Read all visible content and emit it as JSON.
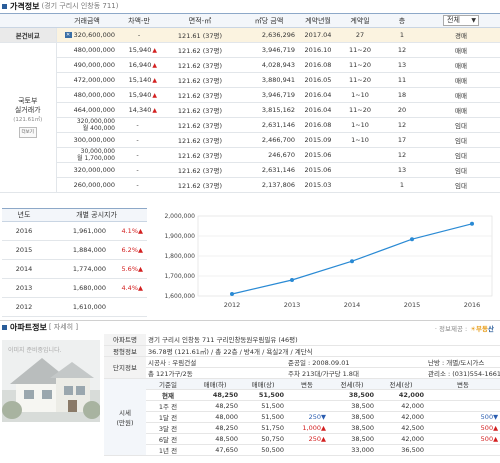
{
  "price_section": {
    "title": "가격정보",
    "subtitle": "(경기 구리시 인창동 711)",
    "headers": {
      "amount": "거래금액",
      "diff": "차액-만",
      "area": "면적-㎡",
      "per_m2": "㎡당 금액",
      "contract_date": "계약년월",
      "contract_day": "계약일",
      "floor": "층"
    },
    "filter": {
      "value": "전체",
      "arrow": "▼"
    },
    "base": {
      "label": "본건비교",
      "badge": "✕",
      "amount": "320,600,000",
      "diff": "-",
      "area": "121.61 (37평)",
      "per_m2": "2,636,296",
      "contract_date": "2017.04",
      "day": "27",
      "floor": "1",
      "type": "경매"
    },
    "group_label_1": "국토부",
    "group_label_2": "실거래가",
    "group_label_3": "(121.61㎡)",
    "group_button": "더보기",
    "rows": [
      {
        "amount": "480,000,000",
        "diff": "15,940",
        "diff_arrow": "▲",
        "area": "121.62 (37평)",
        "per_m2": "3,946,719",
        "date": "2016.10",
        "day": "11~20",
        "floor": "12",
        "type": "매매"
      },
      {
        "amount": "490,000,000",
        "diff": "16,940",
        "diff_arrow": "▲",
        "area": "121.62 (37평)",
        "per_m2": "4,028,943",
        "date": "2016.08",
        "day": "11~20",
        "floor": "13",
        "type": "매매"
      },
      {
        "amount": "472,000,000",
        "diff": "15,140",
        "diff_arrow": "▲",
        "area": "121.62 (37평)",
        "per_m2": "3,880,941",
        "date": "2016.05",
        "day": "11~20",
        "floor": "11",
        "type": "매매"
      },
      {
        "amount": "480,000,000",
        "diff": "15,940",
        "diff_arrow": "▲",
        "area": "121.62 (37평)",
        "per_m2": "3,946,719",
        "date": "2016.04",
        "day": "1~10",
        "floor": "18",
        "type": "매매"
      },
      {
        "amount": "464,000,000",
        "diff": "14,340",
        "diff_arrow": "▲",
        "area": "121.62 (37평)",
        "per_m2": "3,815,162",
        "date": "2016.04",
        "day": "11~20",
        "floor": "20",
        "type": "매매"
      },
      {
        "amount": "320,000,000",
        "amount2": "월 400,000",
        "diff": "-",
        "diff_arrow": "",
        "area": "121.62 (37평)",
        "per_m2": "2,631,146",
        "date": "2016.08",
        "day": "1~10",
        "floor": "12",
        "type": "임대"
      },
      {
        "amount": "300,000,000",
        "diff": "-",
        "diff_arrow": "",
        "area": "121.62 (37평)",
        "per_m2": "2,466,700",
        "date": "2015.09",
        "day": "1~10",
        "floor": "17",
        "type": "임대"
      },
      {
        "amount": "30,000,000",
        "amount2": "월 1,700,000",
        "diff": "-",
        "diff_arrow": "",
        "area": "121.62 (37평)",
        "per_m2": "246,670",
        "date": "2015.06",
        "day": "",
        "floor": "12",
        "type": "임대"
      },
      {
        "amount": "320,000,000",
        "diff": "-",
        "diff_arrow": "",
        "area": "121.62 (37평)",
        "per_m2": "2,631,146",
        "date": "2015.06",
        "day": "",
        "floor": "13",
        "type": "임대"
      },
      {
        "amount": "260,000,000",
        "diff": "-",
        "diff_arrow": "",
        "area": "121.62 (37평)",
        "per_m2": "2,137,806",
        "date": "2015.03",
        "day": "",
        "floor": "1",
        "type": "임대"
      }
    ]
  },
  "official_price": {
    "headers": {
      "year": "년도",
      "price": "개별 공시지가"
    },
    "rows": [
      {
        "year": "2016",
        "price": "1,961,000",
        "pct": "4.1%",
        "arrow": "▲"
      },
      {
        "year": "2015",
        "price": "1,884,000",
        "pct": "6.2%",
        "arrow": "▲"
      },
      {
        "year": "2014",
        "price": "1,774,000",
        "pct": "5.6%",
        "arrow": "▲"
      },
      {
        "year": "2013",
        "price": "1,680,000",
        "pct": "4.4%",
        "arrow": "▲"
      },
      {
        "year": "2012",
        "price": "1,610,000",
        "pct": "",
        "arrow": ""
      }
    ]
  },
  "chart_data": {
    "type": "line",
    "title": "",
    "xlabel": "",
    "ylabel": "",
    "x": [
      "2012",
      "2013",
      "2014",
      "2015",
      "2016"
    ],
    "series": [
      {
        "values": [
          1610000,
          1680000,
          1774000,
          1884000,
          1961000
        ]
      }
    ],
    "ylim": [
      1600000,
      2000000
    ],
    "yticks": [
      "2,000,000",
      "1,900,000",
      "1,800,000",
      "1,700,000",
      "1,600,000"
    ],
    "ytick_values": [
      2000000,
      1900000,
      1800000,
      1700000,
      1600000
    ],
    "line_color": "#2a8ad4",
    "grid": true
  },
  "apt_section": {
    "title": "아파트정보",
    "subtitle": "[ 자세히 ]",
    "brand_text": "· 정보제공 :",
    "brand_logo_a": "부동",
    "brand_logo_b": "산",
    "image_caption": "이미지 준비중입니다.",
    "name_label": "아파트명",
    "name_value": "경기 구리시 인창동 711 구리인창동원우림필유 (46평)",
    "area_label": "평형정보",
    "area_value": "36.78평 (121.61㎡) / 총 22층 / 방4개 / 욕실2개 / 계단식",
    "complex_label": "단지정보",
    "builder_label": "시공사 : 우림건설",
    "approval_label": "준공일 : 2008.09.01",
    "heating_label": "난방 : 개별/도시가스",
    "units_label": "총 121가구/2동",
    "parking_label": "주차 213대/가구당 1.8대",
    "office_label": "관리소 : (031)554-1661",
    "market_label_1": "시세",
    "market_label_2": "(만원)",
    "headers": {
      "base": "기준일",
      "sale_low": "매매(하)",
      "sale_high": "매매(상)",
      "sale_change": "변동",
      "jeonse_low": "전세(하)",
      "jeonse_high": "전세(상)",
      "jeonse_change": "변동"
    },
    "rows": [
      {
        "base": "현재",
        "sale_low": "48,250",
        "sale_high": "51,500",
        "sale_change": "",
        "jeonse_low": "38,500",
        "jeonse_high": "42,000",
        "jeonse_change": ""
      },
      {
        "base": "1주 전",
        "sale_low": "48,250",
        "sale_high": "51,500",
        "sale_change": "",
        "jeonse_low": "38,500",
        "jeonse_high": "42,000",
        "jeonse_change": ""
      },
      {
        "base": "1달 전",
        "sale_low": "48,000",
        "sale_high": "51,500",
        "sale_change": "250▼",
        "jeonse_low": "38,500",
        "jeonse_high": "42,000",
        "jeonse_change": "500▼"
      },
      {
        "base": "3달 전",
        "sale_low": "48,250",
        "sale_high": "51,750",
        "sale_change": "1,000▲",
        "jeonse_low": "38,500",
        "jeonse_high": "42,500",
        "jeonse_change": "500▲"
      },
      {
        "base": "6달 전",
        "sale_low": "48,500",
        "sale_high": "50,750",
        "sale_change": "250▲",
        "jeonse_low": "38,500",
        "jeonse_high": "42,000",
        "jeonse_change": "500▲"
      },
      {
        "base": "1년 전",
        "sale_low": "47,650",
        "sale_high": "50,500",
        "sale_change": "",
        "jeonse_low": "33,000",
        "jeonse_high": "36,500",
        "jeonse_change": ""
      }
    ]
  }
}
